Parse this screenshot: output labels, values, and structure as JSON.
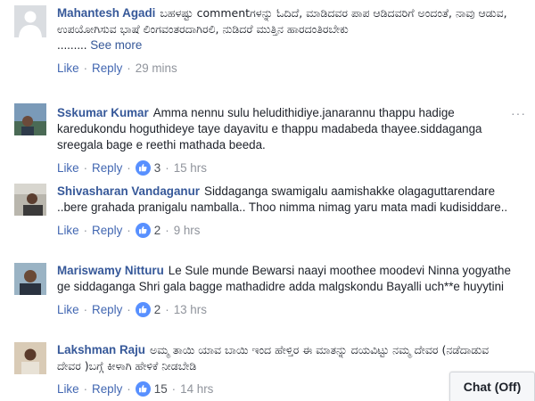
{
  "comments": [
    {
      "author": "Mahantesh Agadi",
      "message": "ಬಹಳಷ್ಟು commentಗಳನ್ನು ಓದಿದೆ, ಮಾಡಿದವರ ಪಾಪ ಆಡಿದವರಿಗೆ ಅಂದಂತೆ, ನಾವು ಆಡುವ, ಉಪಯೋಗಿಸುವ ಭಾಷೆ ಲಿಂಗವಂತರದಾಗಿರಲಿ, ನುಡಿದರೆ ಮುತ್ತಿನ ಹಾರದಂತಿರಬೇಕು",
      "ellipsis": ".........",
      "see_more": "See more",
      "like": "Like",
      "reply": "Reply",
      "reactions": "",
      "time": "29 mins"
    },
    {
      "author": "Sskumar Kumar",
      "message": "Amma nennu sulu heludithidiye.janarannu thappu hadige karedukondu hoguthideye taye dayavitu e thappu madabeda thayee.siddaganga sreegala bage e reethi mathada beeda.",
      "like": "Like",
      "reply": "Reply",
      "reactions": "3",
      "time": "15 hrs"
    },
    {
      "author": "Shivasharan Vandaganur",
      "message": "Siddaganga swamigalu aamishakke olagaguttarendare ..bere grahada pranigalu namballa.. Thoo nimma nimag yaru mata madi kudisiddare..",
      "like": "Like",
      "reply": "Reply",
      "reactions": "2",
      "time": "9 hrs"
    },
    {
      "author": "Mariswamy Nitturu",
      "message": "Le Sule munde Bewarsi naayi moothee moodevi Ninna yogyathe ge siddaganga Shri gala bagge mathadidre adda malgskondu Bayalli uch**e huyytini",
      "like": "Like",
      "reply": "Reply",
      "reactions": "2",
      "time": "13 hrs"
    },
    {
      "author": "Lakshman Raju",
      "message": "ಅಮ್ಮ ತಾಯಿ ಯಾವ ಬಾಯಿ ಇಂದ ಹೇಳ್ತಿರ ಈ ಮಾತನ್ನು ದಯವಿಟ್ಟು ನಮ್ಮ ದೇವರ (ನಡೆದಾಡುವ ದೇವರ )ಬಗ್ಗೆ ಕೀಳಾಗಿ ಹೇಳಿಕೆ ನೀಡಬೇಡಿ",
      "like": "Like",
      "reply": "Reply",
      "reactions": "15",
      "time": "14 hrs"
    }
  ],
  "more_options": "···",
  "chat": {
    "label": "Chat (Off)"
  }
}
